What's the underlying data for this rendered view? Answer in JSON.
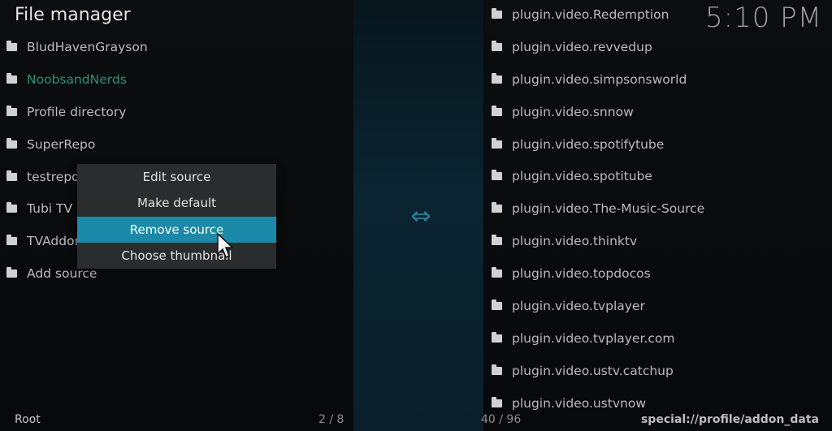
{
  "header": {
    "title": "File manager",
    "clock": "5:10 PM"
  },
  "left_list": [
    {
      "label": "BludHavenGrayson"
    },
    {
      "label": "NoobsandNerds",
      "focused": true
    },
    {
      "label": "Profile directory"
    },
    {
      "label": "SuperRepo"
    },
    {
      "label": "testrepo"
    },
    {
      "label": "Tubi TV"
    },
    {
      "label": "TVAddons"
    },
    {
      "label": "Add source"
    }
  ],
  "right_list": [
    {
      "label": "plugin.video.Redemption"
    },
    {
      "label": "plugin.video.revvedup"
    },
    {
      "label": "plugin.video.simpsonsworld"
    },
    {
      "label": "plugin.video.snnow"
    },
    {
      "label": "plugin.video.spotifytube"
    },
    {
      "label": "plugin.video.spotitube"
    },
    {
      "label": "plugin.video.The-Music-Source"
    },
    {
      "label": "plugin.video.thinktv"
    },
    {
      "label": "plugin.video.topdocos"
    },
    {
      "label": "plugin.video.tvplayer"
    },
    {
      "label": "plugin.video.tvplayer.com"
    },
    {
      "label": "plugin.video.ustv.catchup"
    },
    {
      "label": "plugin.video.ustvnow"
    }
  ],
  "context_menu": {
    "items": [
      {
        "label": "Edit source"
      },
      {
        "label": "Make default"
      },
      {
        "label": "Remove source",
        "selected": true
      },
      {
        "label": "Choose thumbnail"
      }
    ]
  },
  "footer": {
    "left_label": "Root",
    "left_count": "2 / 8",
    "right_count": "40 / 96",
    "right_path": "special://profile/addon_data"
  },
  "icons": {
    "folder": "folder-icon",
    "swap": "swap-arrows-icon",
    "cursor": "mouse-pointer-icon"
  },
  "colors": {
    "accent": "#1b89a9",
    "focused_text": "#2f8f7d",
    "menu_bg": "#2a2c2e"
  }
}
